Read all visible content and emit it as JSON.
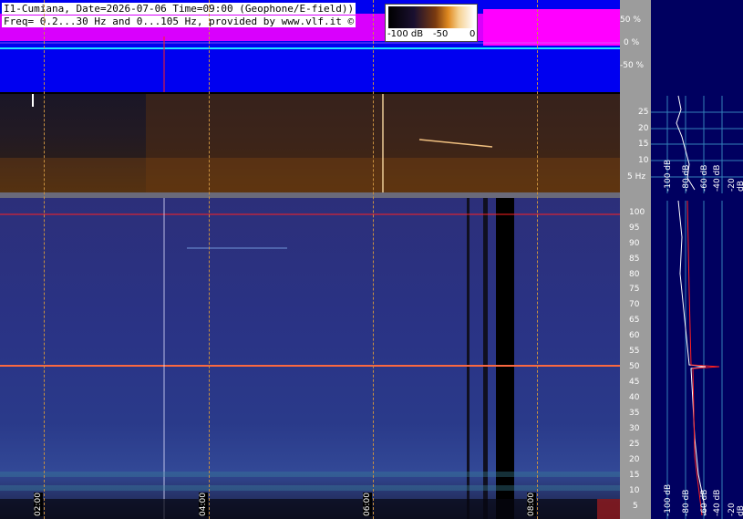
{
  "header": {
    "line1": "I1-Cumiana, Date=2026-07-06 Time=09:00 (Geophone/E-field))",
    "line2": "Freq= 0.2...30 Hz and 0...105 Hz, provided by www.vlf.it ©"
  },
  "colorbar": {
    "labels": [
      "-100 dB",
      "-50",
      "0"
    ]
  },
  "waveform_axis": [
    "50 %",
    "0 %",
    "-50 %"
  ],
  "low_freq_axis": [
    "25",
    "20",
    "15",
    "10",
    "5 Hz"
  ],
  "high_freq_axis": [
    "100",
    "95",
    "90",
    "85",
    "80",
    "75",
    "70",
    "65",
    "60",
    "55",
    "50",
    "45",
    "40",
    "35",
    "30",
    "25",
    "20",
    "15",
    "10",
    "5"
  ],
  "time_labels": [
    "02:00",
    "04:00",
    "06:00",
    "08:00"
  ],
  "side_db_labels_top": [
    "-100 dB",
    "-80 dB",
    "-60 dB",
    "-40 dB",
    "-20 dB"
  ],
  "side_db_labels_bottom": [
    "-100 dB",
    "-80 dB",
    "-60 dB",
    "-40 dB",
    "-20 dB"
  ],
  "colors": {
    "waveform_bg": "#0000f0",
    "waveform_trace": "#ff00ff",
    "panel_bg": "#000060",
    "accent_red": "#ff2020"
  }
}
